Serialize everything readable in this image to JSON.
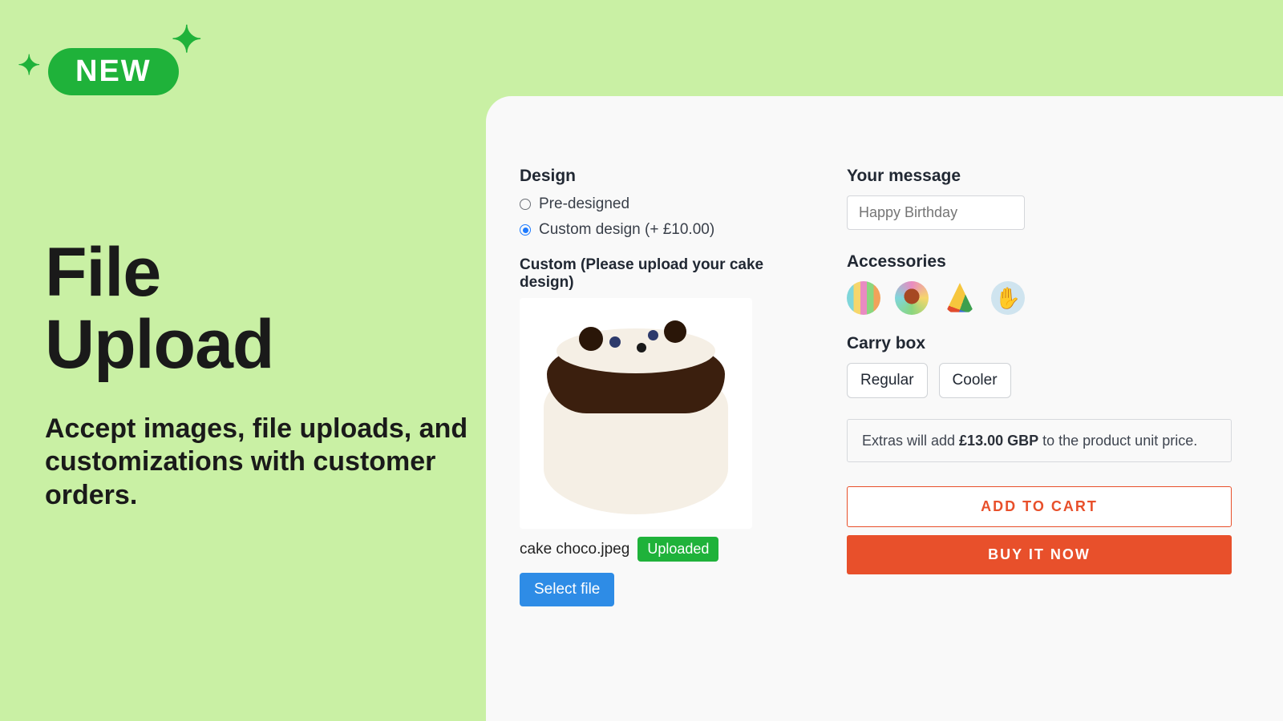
{
  "badge": {
    "label": "NEW"
  },
  "hero": {
    "title_line1": "File",
    "title_line2": "Upload",
    "subtitle": "Accept images, file uploads, and customizations with customer orders."
  },
  "design": {
    "label": "Design",
    "options": [
      {
        "label": "Pre-designed",
        "selected": false
      },
      {
        "label": "Custom design (+ £10.00)",
        "selected": true
      }
    ]
  },
  "upload": {
    "label": "Custom (Please upload your cake design)",
    "filename": "cake choco.jpeg",
    "status": "Uploaded",
    "button": "Select file"
  },
  "message": {
    "label": "Your message",
    "placeholder": "Happy Birthday"
  },
  "accessories": {
    "label": "Accessories",
    "items": [
      "candles",
      "sprinkles",
      "party-hat",
      "hand-print"
    ]
  },
  "carrybox": {
    "label": "Carry box",
    "options": [
      "Regular",
      "Cooler"
    ]
  },
  "extras": {
    "prefix": "Extras will add ",
    "amount": "£13.00 GBP",
    "suffix": " to the product unit price."
  },
  "buttons": {
    "add": "ADD TO CART",
    "buy": "BUY IT NOW"
  }
}
